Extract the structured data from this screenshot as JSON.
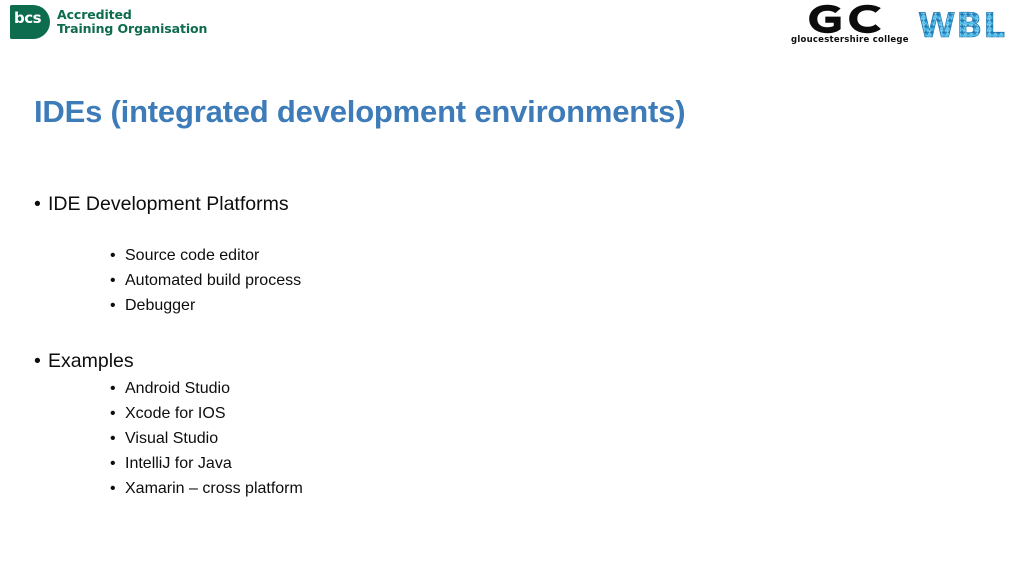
{
  "slide": {
    "background_color": "#ffffff",
    "title": "IDEs (integrated development environments)",
    "title_color": "#3d7cb8",
    "body_text_color": "#0d0d0d"
  },
  "logos": {
    "bcs": {
      "name": "bcs-accredited-training-organisation-logo",
      "mark_text": "bcs",
      "line1": "Accredited",
      "line2": "Training Organisation",
      "color": "#0d6b4e"
    },
    "gloucestershire_college": {
      "name": "gloucestershire-college-logo",
      "mark_text": "GC",
      "caption": "gloucestershire college",
      "color": "#0c0c0c"
    },
    "wbl": {
      "name": "wbl-logo",
      "mark_text": "WBL",
      "color": "#29a8df"
    }
  },
  "content": {
    "groups": [
      {
        "id": "platforms",
        "heading": "IDE Development Platforms",
        "bullet": "•",
        "items": [
          "Source code editor",
          "Automated build process",
          "Debugger"
        ]
      },
      {
        "id": "examples",
        "heading": "Examples",
        "bullet": "•",
        "items": [
          "Android Studio",
          "Xcode for IOS",
          "Visual Studio",
          "IntelliJ for Java",
          "Xamarin – cross platform"
        ]
      }
    ]
  }
}
